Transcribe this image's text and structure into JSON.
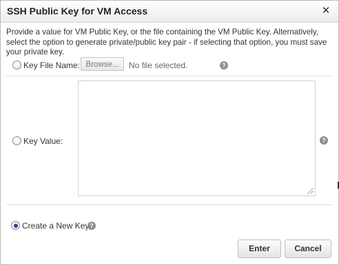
{
  "dialog": {
    "title": "SSH Public Key for VM Access",
    "close_symbol": "✕",
    "description": "Provide a value for VM Public Key, or the file containing the VM Public Key. Alternatively, select the option to generate private/public key pair - if selecting that option, you must save your private key."
  },
  "key_file": {
    "label": "Key File Name:",
    "browse_label": "Browse...",
    "status": "No file selected.",
    "help_icon": "question-icon",
    "help_symbol": "?"
  },
  "key_value": {
    "label": "Key Value:",
    "value": "",
    "help_icon": "question-icon",
    "help_symbol": "?"
  },
  "new_key": {
    "label": "Create a New Key",
    "selected": true,
    "help_icon": "question-icon",
    "help_symbol": "?"
  },
  "buttons": {
    "enter": "Enter",
    "cancel": "Cancel"
  }
}
